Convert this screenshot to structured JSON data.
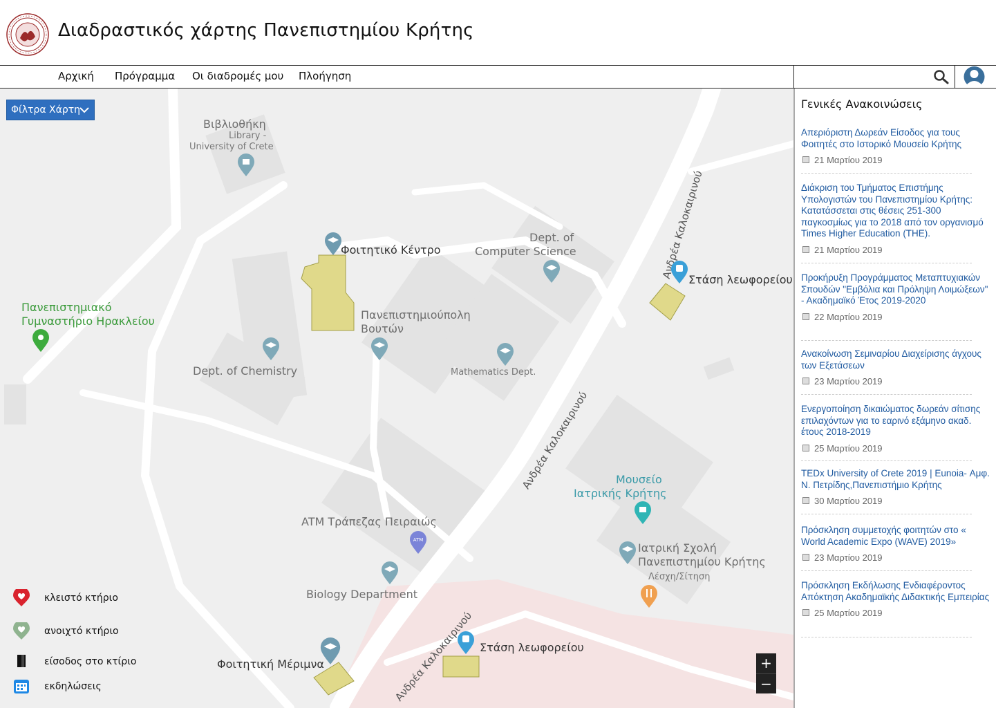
{
  "header": {
    "title": "Διαδραστικός χάρτης Πανεπιστημίου Κρήτης",
    "logo_icon": "university-seal-icon"
  },
  "nav": {
    "items": [
      "Αρχική",
      "Πρόγραμμα",
      "Οι διαδρομές μου",
      "Πλοήγηση"
    ],
    "search_placeholder": "",
    "search_icon": "search-icon",
    "avatar_icon": "user-avatar-icon"
  },
  "map": {
    "filter_label": "Φίλτρα Χάρτη",
    "labels": {
      "library_gr": "Βιβλιοθήκη",
      "library_en1": "Library -",
      "library_en2": "University of Crete",
      "student_center": "Φοιτητικό Κέντρο",
      "cs_dept1": "Dept. of",
      "cs_dept2": "Computer Science",
      "gym1": "Πανεπιστημιακό",
      "gym2": "Γυμναστήριο Ηρακλείου",
      "campus1": "Πανεπιστημιούπολη",
      "campus2": "Βουτών",
      "chemistry": "Dept. of Chemistry",
      "math": "Mathematics Dept.",
      "bus_stop_1": "Στάση λεωφορείου",
      "bus_stop_2": "Στάση λεωφορείου",
      "road_1": "Ανδρέα Καλοκαιρινού",
      "road_2": "Ανδρέα Καλοκαιρινού",
      "road_3": "Ανδρέα Καλοκαιρινού",
      "museum1": "Μουσείο",
      "museum2": "Ιατρικής Κρήτης",
      "atm": "ATM Τράπεζας Πειραιώς",
      "medical1": "Ιατρική Σχολή",
      "medical2": "Πανεπιστημίου Κρήτης",
      "club": "Λέσχη/Σίτηση",
      "biology": "Biology Department",
      "dorm": "Φοιτητική Μέριμνα",
      "atm_badge": "ATM"
    },
    "zoom_in": "+",
    "zoom_out": "−",
    "legend": [
      {
        "label": "κλειστό κτήριο",
        "icon": "closed-building-heart-icon",
        "color": "#d9232e"
      },
      {
        "label": "ανοιχτό κτήριο",
        "icon": "open-building-heart-icon",
        "color": "#8fb38f"
      },
      {
        "label": "είσοδος στο κτίριο",
        "icon": "door-entrance-icon",
        "color": "#111111"
      },
      {
        "label": "εκδηλώσεις",
        "icon": "calendar-events-icon",
        "color": "#1e88e5"
      }
    ]
  },
  "sidebar": {
    "title": "Γενικές Ανακοινώσεις",
    "announcements": [
      {
        "text": "Απεριόριστη Δωρεάν Είσοδος για τους Φοιτητές στο Ιστορικό Μουσείο Κρήτης",
        "date": "21 Μαρτίου 2019"
      },
      {
        "text": "Διάκριση του Τμήματος Επιστήμης Υπολογιστών του Πανεπιστημίου Κρήτης: Κατατάσσεται στις θέσεις 251-300 παγκοσμίως για το 2018 από τον οργανισμό Times Higher Education (THE).",
        "date": "21 Μαρτίου 2019"
      },
      {
        "text": "Προκήρυξη Προγράμματος Μεταπτυχιακών Σπουδών \"Εμβόλια και Πρόληψη Λοιμώξεων\" - Ακαδημαϊκό Έτος 2019-2020",
        "date": "22 Μαρτίου 2019"
      },
      {
        "text": "Ανακοίνωση Σεμιναρίου Διαχείρισης άγχους των Εξετάσεων",
        "date": "23 Μαρτίου 2019"
      },
      {
        "text": "Ενεργοποίηση δικαιώματος δωρεάν σίτισης επιλαχόντων για το εαρινό εξάμηνο ακαδ. έτους 2018-2019",
        "date": "25 Μαρτίου 2019"
      },
      {
        "text": "TEDx University of Crete 2019 | Eunoia- Αμφ. Ν. Πετρίδης,Πανεπιστήμιο Κρήτης",
        "date": "30 Μαρτίου 2019"
      },
      {
        "text": "Πρόσκληση συμμετοχής φοιτητών στο « World Academic Expo (WAVE) 2019»",
        "date": "23 Μαρτίου 2019"
      },
      {
        "text": "Πρόσκληση Εκδήλωσης Ενδιαφέροντος Απόκτηση Ακαδημαϊκής Διδακτικής Εμπειρίας",
        "date": "25 Μαρτίου 2019"
      }
    ]
  }
}
